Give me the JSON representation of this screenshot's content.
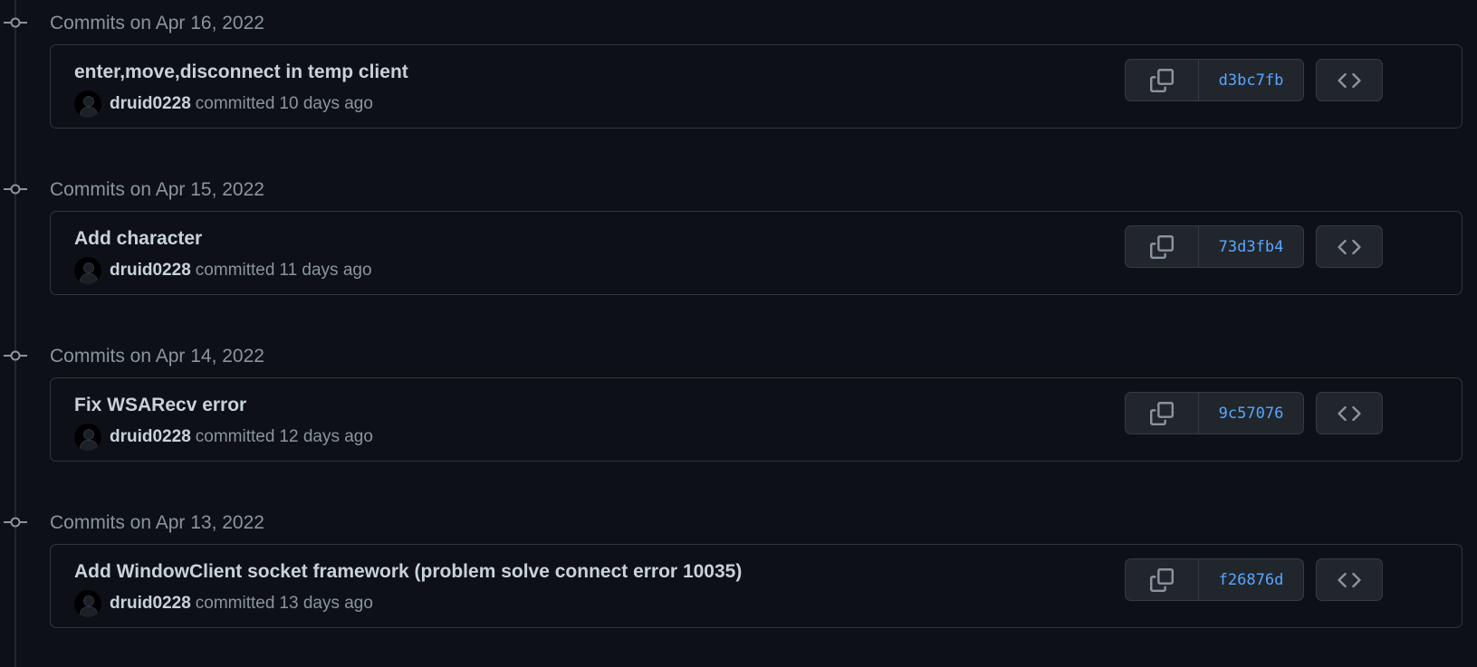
{
  "colors": {
    "background": "#0d1117",
    "border": "#30363d",
    "button_bg": "#21262d",
    "muted_text": "#8b949e",
    "primary_text": "#c9d1d9",
    "sha_link": "#58a6ff"
  },
  "groups": [
    {
      "title": "Commits on Apr 16, 2022",
      "commit": {
        "message": "enter,move,disconnect in temp client",
        "author": "druid0228",
        "action": "committed",
        "time": "10 days ago",
        "sha": "d3bc7fb",
        "copy_icon": "copy-icon",
        "browse_icon": "code-icon"
      }
    },
    {
      "title": "Commits on Apr 15, 2022",
      "commit": {
        "message": "Add character",
        "author": "druid0228",
        "action": "committed",
        "time": "11 days ago",
        "sha": "73d3fb4",
        "copy_icon": "copy-icon",
        "browse_icon": "code-icon"
      }
    },
    {
      "title": "Commits on Apr 14, 2022",
      "commit": {
        "message": "Fix WSARecv error",
        "author": "druid0228",
        "action": "committed",
        "time": "12 days ago",
        "sha": "9c57076",
        "copy_icon": "copy-icon",
        "browse_icon": "code-icon"
      }
    },
    {
      "title": "Commits on Apr 13, 2022",
      "commit": {
        "message": "Add WindowClient socket framework (problem solve connect error 10035)",
        "author": "druid0228",
        "action": "committed",
        "time": "13 days ago",
        "sha": "f26876d",
        "copy_icon": "copy-icon",
        "browse_icon": "code-icon"
      }
    }
  ]
}
